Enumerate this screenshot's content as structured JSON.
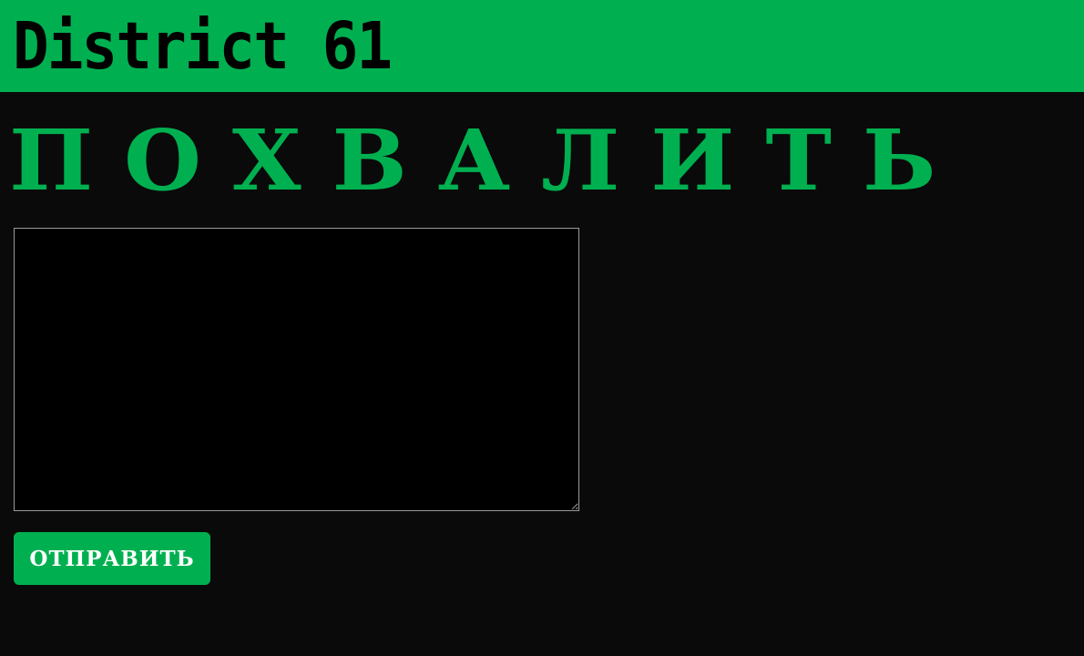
{
  "header": {
    "site_title": "District 61"
  },
  "main": {
    "heading": "ПОХВАЛИТЬ",
    "message": {
      "value": "",
      "placeholder": ""
    },
    "submit_label": "ОТПРАВИТЬ"
  },
  "colors": {
    "accent": "#00b050",
    "background": "#0a0a0a",
    "input_background": "#000000",
    "input_border": "#9a9a9a",
    "button_text": "#ffffff"
  }
}
